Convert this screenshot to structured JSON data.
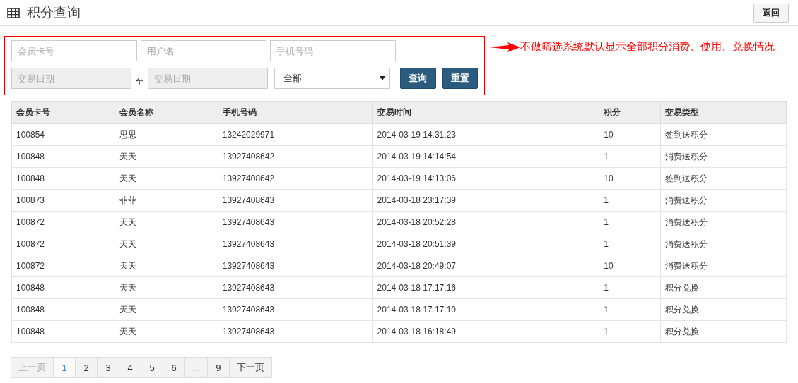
{
  "header": {
    "title": "积分查询",
    "back_button": "返回"
  },
  "filters": {
    "card_no": {
      "placeholder": "会员卡号"
    },
    "username": {
      "placeholder": "用户名"
    },
    "phone": {
      "placeholder": "手机号码"
    },
    "date_from": {
      "placeholder": "交易日期",
      "disabled": true
    },
    "separator": "至",
    "date_to": {
      "placeholder": "交易日期",
      "disabled": true
    },
    "type_select": {
      "value": "全部"
    },
    "buttons": [
      "查询",
      "重置"
    ]
  },
  "annotation": "不做筛选系统默认显示全部积分消费、使用、兑换情况",
  "table": {
    "columns": [
      "会员卡号",
      "会员名称",
      "手机号码",
      "交易时间",
      "积分",
      "交易类型"
    ],
    "rows": [
      [
        "100854",
        "思思",
        "13242029971",
        "2014-03-19 14:31:23",
        "10",
        "签到送积分"
      ],
      [
        "100848",
        "天天",
        "13927408642",
        "2014-03-19 14:14:54",
        "1",
        "消费送积分"
      ],
      [
        "100848",
        "天天",
        "13927408642",
        "2014-03-19 14:13:06",
        "10",
        "签到送积分"
      ],
      [
        "100873",
        "菲菲",
        "13927408643",
        "2014-03-18 23:17:39",
        "1",
        "消费送积分"
      ],
      [
        "100872",
        "天天",
        "13927408643",
        "2014-03-18 20:52:28",
        "1",
        "消费送积分"
      ],
      [
        "100872",
        "天天",
        "13927408643",
        "2014-03-18 20:51:39",
        "1",
        "消费送积分"
      ],
      [
        "100872",
        "天天",
        "13927408643",
        "2014-03-18 20:49:07",
        "10",
        "消费送积分"
      ],
      [
        "100848",
        "天天",
        "13927408643",
        "2014-03-18 17:17:16",
        "1",
        "积分兑换"
      ],
      [
        "100848",
        "天天",
        "13927408643",
        "2014-03-18 17:17:10",
        "1",
        "积分兑换"
      ],
      [
        "100848",
        "天天",
        "13927408643",
        "2014-03-18 16:18:49",
        "1",
        "积分兑换"
      ]
    ]
  },
  "pagination": [
    {
      "label": "上一页",
      "selected": false,
      "disabled": true
    },
    {
      "label": "1",
      "selected": true,
      "disabled": false
    },
    {
      "label": "2",
      "selected": false,
      "disabled": false
    },
    {
      "label": "3",
      "selected": false,
      "disabled": false
    },
    {
      "label": "4",
      "selected": false,
      "disabled": false
    },
    {
      "label": "5",
      "selected": false,
      "disabled": false
    },
    {
      "label": "6",
      "selected": false,
      "disabled": false
    },
    {
      "label": "...",
      "selected": false,
      "disabled": true
    },
    {
      "label": "9",
      "selected": false,
      "disabled": false
    },
    {
      "label": "下一页",
      "selected": false,
      "disabled": false
    }
  ]
}
